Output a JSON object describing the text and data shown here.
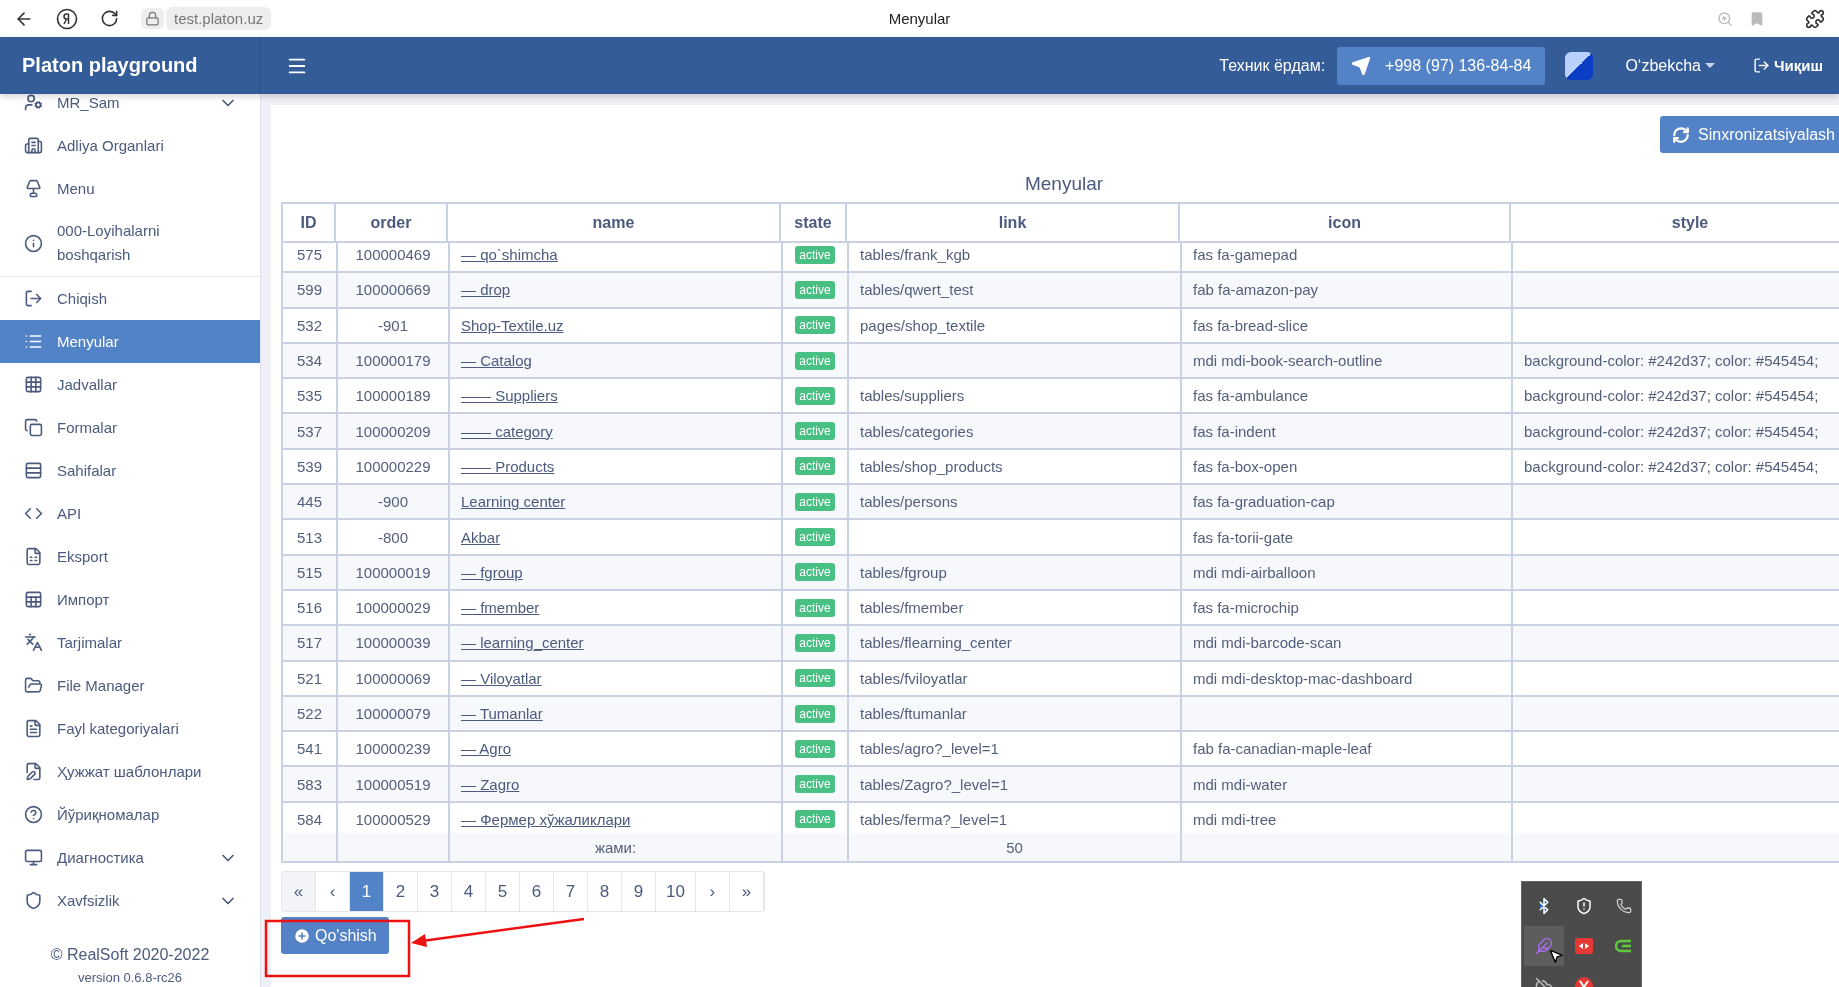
{
  "browser": {
    "url": "test.platon.uz",
    "title": "Menyular"
  },
  "header": {
    "brand": "Platon playground",
    "tech_label": "Техник ёрдам:",
    "phone": "+998 (97) 136-84-84",
    "language": "O‘zbekcha",
    "logout": "Чиқиш"
  },
  "sidebar": {
    "items": [
      {
        "label": "MR_Sam",
        "kind": "group",
        "selected": false
      },
      {
        "label": "Adliya Organlari",
        "kind": "link",
        "selected": false
      },
      {
        "label": "Menu",
        "kind": "link",
        "selected": false
      },
      {
        "label": "000-Loyihalarni boshqarish",
        "kind": "link",
        "selected": false
      },
      {
        "label": "Chiqish",
        "kind": "link",
        "selected": false
      },
      {
        "label": "Menyular",
        "kind": "link",
        "selected": true
      },
      {
        "label": "Jadvallar",
        "kind": "link",
        "selected": false
      },
      {
        "label": "Formalar",
        "kind": "link",
        "selected": false
      },
      {
        "label": "Sahifalar",
        "kind": "link",
        "selected": false
      },
      {
        "label": "API",
        "kind": "link",
        "selected": false
      },
      {
        "label": "Eksport",
        "kind": "link",
        "selected": false
      },
      {
        "label": "Импорт",
        "kind": "link",
        "selected": false
      },
      {
        "label": "Tarjimalar",
        "kind": "link",
        "selected": false
      },
      {
        "label": "File Manager",
        "kind": "link",
        "selected": false
      },
      {
        "label": "Fayl kategoriyalari",
        "kind": "link",
        "selected": false
      },
      {
        "label": "Ҳужжат шаблонлари",
        "kind": "link",
        "selected": false
      },
      {
        "label": "Йўриқномалар",
        "kind": "link",
        "selected": false
      },
      {
        "label": "Диагностика",
        "kind": "group",
        "selected": false
      },
      {
        "label": "Xavfsizlik",
        "kind": "group",
        "selected": false
      }
    ],
    "copyright": "© RealSoft 2020-2022",
    "version": "version 0.6.8-rc26"
  },
  "page": {
    "sync_button": "Sinxronizatsiyalash",
    "title": "Menyular",
    "table": {
      "columns": [
        "ID",
        "order",
        "name",
        "state",
        "link",
        "icon",
        "style"
      ],
      "rows": [
        {
          "id": "575",
          "order": "100000469",
          "name": "— qo`shimcha",
          "state": "active",
          "link": "tables/frank_kgb",
          "icon": "fas fa-gamepad"
        },
        {
          "id": "599",
          "order": "100000669",
          "name": "— drop",
          "state": "active",
          "link": "tables/qwert_test",
          "icon": "fab fa-amazon-pay"
        },
        {
          "id": "532",
          "order": "-901",
          "name": "Shop-Textile.uz",
          "state": "active",
          "link": "pages/shop_textile",
          "icon": "fas fa-bread-slice"
        },
        {
          "id": "534",
          "order": "100000179",
          "name": "— Catalog",
          "state": "active",
          "icon": "mdi mdi-book-search-outline",
          "style": "background-color: #242d37; color: #545454;"
        },
        {
          "id": "535",
          "order": "100000189",
          "name": "—— Suppliers",
          "state": "active",
          "link": "tables/suppliers",
          "icon": "fas fa-ambulance",
          "style": "background-color: #242d37; color: #545454;"
        },
        {
          "id": "537",
          "order": "100000209",
          "name": "—— category",
          "state": "active",
          "link": "tables/categories",
          "icon": "fas fa-indent",
          "style": "background-color: #242d37; color: #545454;"
        },
        {
          "id": "539",
          "order": "100000229",
          "name": "—— Products",
          "state": "active",
          "link": "tables/shop_products",
          "icon": "fas fa-box-open",
          "style": "background-color: #242d37; color: #545454;"
        },
        {
          "id": "445",
          "order": "-900",
          "name": "Learning center",
          "state": "active",
          "link": "tables/persons",
          "icon": "fas fa-graduation-cap"
        },
        {
          "id": "513",
          "order": "-800",
          "name": "Akbar",
          "state": "active",
          "icon": "fas fa-torii-gate"
        },
        {
          "id": "515",
          "order": "100000019",
          "name": "— fgroup",
          "state": "active",
          "link": "tables/fgroup",
          "icon": "mdi mdi-airballoon"
        },
        {
          "id": "516",
          "order": "100000029",
          "name": "— fmember",
          "state": "active",
          "link": "tables/fmember",
          "icon": "fas fa-microchip"
        },
        {
          "id": "517",
          "order": "100000039",
          "name": "— learning_center",
          "state": "active",
          "link": "tables/flearning_center",
          "icon": "mdi mdi-barcode-scan"
        },
        {
          "id": "521",
          "order": "100000069",
          "name": "— Viloyatlar",
          "state": "active",
          "link": "tables/fviloyatlar",
          "icon": "mdi mdi-desktop-mac-dashboard"
        },
        {
          "id": "522",
          "order": "100000079",
          "name": "— Tumanlar",
          "state": "active",
          "link": "tables/ftumanlar"
        },
        {
          "id": "541",
          "order": "100000239",
          "name": "— Agro",
          "state": "active",
          "link": "tables/agro?_level=1",
          "icon": "fab fa-canadian-maple-leaf"
        },
        {
          "id": "583",
          "order": "100000519",
          "name": "— Zagro",
          "state": "active",
          "link": "tables/Zagro?_level=1",
          "icon": "mdi mdi-water"
        },
        {
          "id": "584",
          "order": "100000529",
          "name": "— Фермер хўжаликлари",
          "state": "active",
          "link": "tables/ferma?_level=1",
          "icon": "mdi mdi-tree"
        }
      ],
      "footer": {
        "label": "жами:",
        "total": "50"
      }
    },
    "pagination": {
      "pages": [
        {
          "label": "«",
          "selected": false
        },
        {
          "label": "‹",
          "selected": false
        },
        {
          "label": "1",
          "selected": true
        },
        {
          "label": "2",
          "selected": false
        },
        {
          "label": "3",
          "selected": false
        },
        {
          "label": "4",
          "selected": false
        },
        {
          "label": "5",
          "selected": false
        },
        {
          "label": "6",
          "selected": false
        },
        {
          "label": "7",
          "selected": false
        },
        {
          "label": "8",
          "selected": false
        },
        {
          "label": "9",
          "selected": false
        },
        {
          "label": "10",
          "selected": false
        },
        {
          "label": "›",
          "selected": false
        },
        {
          "label": "»",
          "selected": false
        }
      ]
    },
    "add_button": "Qo'shish"
  }
}
